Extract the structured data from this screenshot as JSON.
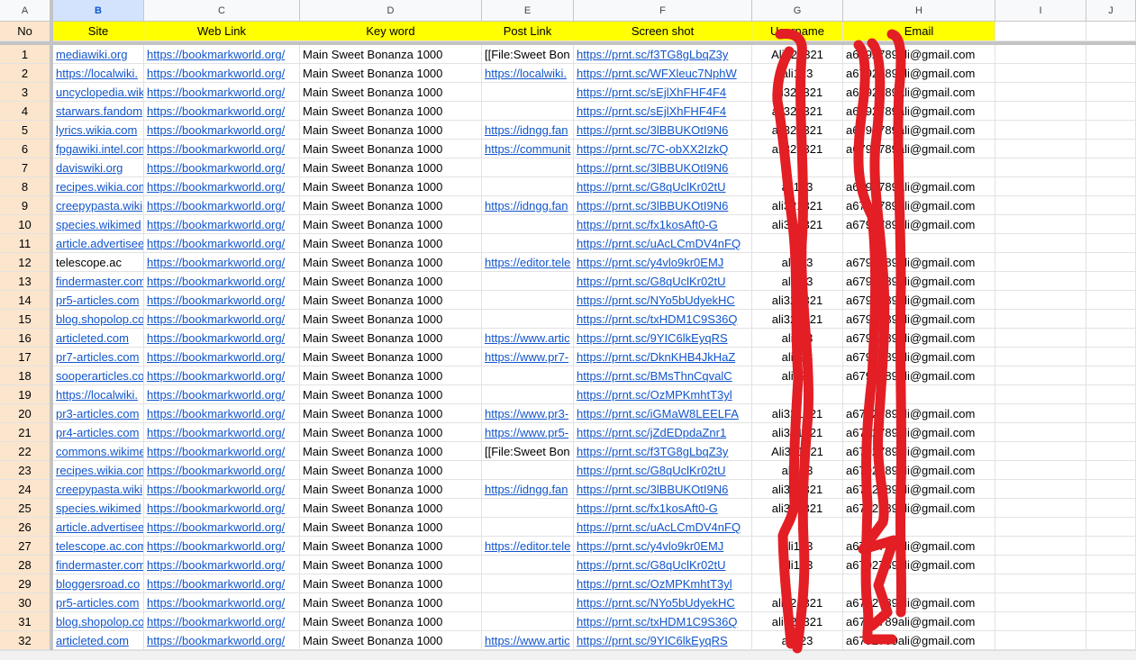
{
  "columns": [
    "A",
    "B",
    "C",
    "D",
    "E",
    "F",
    "G",
    "H",
    "I",
    "J"
  ],
  "selected_column": "B",
  "headers": [
    "No",
    "Site",
    "Web Link",
    "Key word",
    "Post  Link",
    "Screen shot",
    "Username",
    "Email",
    "",
    ""
  ],
  "colors": {
    "header_bg": "#ffff00",
    "no_bg": "#fce5cd",
    "link": "#1155cc",
    "scribble": "#e31e24"
  },
  "rows": [
    {
      "no": "1",
      "site": "mediawiki.org",
      "web": "https://bookmarkworld.org/",
      "kw": "Main Sweet Bonanza 1000",
      "post": "[[File:Sweet Bon",
      "post_link": false,
      "shot": "https://prnt.sc/f3TG8gLbqZ3y",
      "user": "Ali321321",
      "email": "a6792789ali@gmail.com"
    },
    {
      "no": "2",
      "site": "https://localwiki.",
      "web": "https://bookmarkworld.org/",
      "kw": "Main Sweet Bonanza 1000",
      "post": "https://localwiki.",
      "shot": "https://prnt.sc/WFXleuc7NphW",
      "user": "ali123",
      "email": "a6792789ali@gmail.com"
    },
    {
      "no": "3",
      "site": "uncyclopedia.wiki",
      "web": "https://bookmarkworld.org/",
      "kw": "Main Sweet Bonanza 1000",
      "post": "",
      "shot": "https://prnt.sc/sEjlXhFHF4F4",
      "user": "ali321321",
      "email": "a6792789ali@gmail.com"
    },
    {
      "no": "4",
      "site": "starwars.fandom",
      "web": "https://bookmarkworld.org/",
      "kw": "Main Sweet Bonanza 1000",
      "post": "",
      "shot": "https://prnt.sc/sEjlXhFHF4F4",
      "user": "ali321321",
      "email": "a6792789ali@gmail.com"
    },
    {
      "no": "5",
      "site": "lyrics.wikia.com",
      "web": "https://bookmarkworld.org/",
      "kw": "Main Sweet Bonanza 1000",
      "post": "https://idngg.fan",
      "shot": "https://prnt.sc/3lBBUKOtI9N6",
      "user": "ali321321",
      "email": "a6792789ali@gmail.com"
    },
    {
      "no": "6",
      "site": "fpgawiki.intel.com",
      "web": "https://bookmarkworld.org/",
      "kw": "Main Sweet Bonanza 1000",
      "post": "https://communit",
      "shot": "https://prnt.sc/7C-obXX2IzkQ",
      "user": "ali321321",
      "email": "a6792789ali@gmail.com"
    },
    {
      "no": "7",
      "site": "daviswiki.org",
      "web": "https://bookmarkworld.org/",
      "kw": "Main Sweet Bonanza 1000",
      "post": "",
      "shot": "https://prnt.sc/3lBBUKOtI9N6",
      "user": "",
      "email": ""
    },
    {
      "no": "8",
      "site": "recipes.wikia.com",
      "web": "https://bookmarkworld.org/",
      "kw": "Main Sweet Bonanza 1000",
      "post": "",
      "shot": "https://prnt.sc/G8qUclKr02tU",
      "user": "ali123",
      "email": "a6792789ali@gmail.com"
    },
    {
      "no": "9",
      "site": "creepypasta.wiki",
      "web": "https://bookmarkworld.org/",
      "kw": "Main Sweet Bonanza 1000",
      "post": "https://idngg.fan",
      "shot": "https://prnt.sc/3lBBUKOtI9N6",
      "user": "ali321321",
      "email": "a6792789ali@gmail.com"
    },
    {
      "no": "10",
      "site": "species.wikimed",
      "web": "https://bookmarkworld.org/",
      "kw": "Main Sweet Bonanza 1000",
      "post": "",
      "shot": "https://prnt.sc/fx1kosAft0-G",
      "user": "ali321321",
      "email": "a6792789ali@gmail.com"
    },
    {
      "no": "11",
      "site": "article.advertisee",
      "web": "https://bookmarkworld.org/",
      "kw": "Main Sweet Bonanza 1000",
      "post": "",
      "shot": "https://prnt.sc/uAcLCmDV4nFQ",
      "user": "",
      "email": ""
    },
    {
      "no": "12",
      "site": "telescope.ac",
      "site_plain": true,
      "web": "https://bookmarkworld.org/",
      "kw": "Main Sweet Bonanza 1000",
      "post": "https://editor.tele",
      "shot": "https://prnt.sc/y4vlo9kr0EMJ",
      "user": "ali123",
      "email": "a6792789ali@gmail.com"
    },
    {
      "no": "13",
      "site": "findermaster.com",
      "web": "https://bookmarkworld.org/",
      "kw": "Main Sweet Bonanza 1000",
      "post": "",
      "shot": "https://prnt.sc/G8qUclKr02tU",
      "user": "ali123",
      "email": "a6792789ali@gmail.com"
    },
    {
      "no": "14",
      "site": "pr5-articles.com",
      "web": "https://bookmarkworld.org/",
      "kw": "Main Sweet Bonanza 1000",
      "post": "",
      "shot": "https://prnt.sc/NYo5bUdyekHC",
      "user": "ali321321",
      "email": "a6792789ali@gmail.com"
    },
    {
      "no": "15",
      "site": "blog.shopolop.co",
      "web": "https://bookmarkworld.org/",
      "kw": "Main Sweet Bonanza 1000",
      "post": "",
      "shot": "https://prnt.sc/txHDM1C9S36Q",
      "user": "ali321321",
      "email": "a6792789ali@gmail.com"
    },
    {
      "no": "16",
      "site": "articleted.com",
      "web": "https://bookmarkworld.org/",
      "kw": "Main Sweet Bonanza 1000",
      "post": "https://www.artic",
      "shot": "https://prnt.sc/9YIC6lkEyqRS",
      "user": "ali123",
      "email": "a6792789ali@gmail.com"
    },
    {
      "no": "17",
      "site": "pr7-articles.com",
      "web": "https://bookmarkworld.org/",
      "kw": "Main Sweet Bonanza 1000",
      "post": "https://www.pr7-",
      "shot": "https://prnt.sc/DknKHB4JkHaZ",
      "user": "ali123",
      "email": "a6792789ali@gmail.com"
    },
    {
      "no": "18",
      "site": "sooperarticles.co",
      "web": "https://bookmarkworld.org/",
      "kw": "Main Sweet Bonanza 1000",
      "post": "",
      "shot": "https://prnt.sc/BMsThnCqvalC",
      "user": "ali123",
      "email": "a6792789ali@gmail.com"
    },
    {
      "no": "19",
      "site": "https://localwiki.",
      "web": "https://bookmarkworld.org/",
      "kw": "Main Sweet Bonanza 1000",
      "post": "",
      "shot": "https://prnt.sc/OzMPKmhtT3yl",
      "user": "",
      "email": ""
    },
    {
      "no": "20",
      "site": "pr3-articles.com",
      "web": "https://bookmarkworld.org/",
      "kw": "Main Sweet Bonanza 1000",
      "post": "https://www.pr3-",
      "shot": "https://prnt.sc/iGMaW8LEELFA",
      "user": "ali321321",
      "email": "a6792789ali@gmail.com"
    },
    {
      "no": "21",
      "site": "pr4-articles.com",
      "web": "https://bookmarkworld.org/",
      "kw": "Main Sweet Bonanza 1000",
      "post": "https://www.pr5-",
      "shot": "https://prnt.sc/jZdEDpdaZnr1",
      "user": "ali321321",
      "email": "a6792789ali@gmail.com"
    },
    {
      "no": "22",
      "site": "commons.wikime",
      "web": "https://bookmarkworld.org/",
      "kw": "Main Sweet Bonanza 1000",
      "post": "[[File:Sweet Bon",
      "post_link": false,
      "shot": "https://prnt.sc/f3TG8gLbqZ3y",
      "user": "Ali321321",
      "email": "a6792789ali@gmail.com"
    },
    {
      "no": "23",
      "site": "recipes.wikia.com",
      "web": "https://bookmarkworld.org/",
      "kw": "Main Sweet Bonanza 1000",
      "post": "",
      "shot": "https://prnt.sc/G8qUclKr02tU",
      "user": "ali123",
      "email": "a6792789ali@gmail.com"
    },
    {
      "no": "24",
      "site": "creepypasta.wiki",
      "web": "https://bookmarkworld.org/",
      "kw": "Main Sweet Bonanza 1000",
      "post": "https://idngg.fan",
      "shot": "https://prnt.sc/3lBBUKOtI9N6",
      "user": "ali321321",
      "email": "a6792789ali@gmail.com"
    },
    {
      "no": "25",
      "site": "species.wikimed",
      "web": "https://bookmarkworld.org/",
      "kw": "Main Sweet Bonanza 1000",
      "post": "",
      "shot": "https://prnt.sc/fx1kosAft0-G",
      "user": "ali321321",
      "email": "a6792789ali@gmail.com"
    },
    {
      "no": "26",
      "site": "article.advertisee",
      "web": "https://bookmarkworld.org/",
      "kw": "Main Sweet Bonanza 1000",
      "post": "",
      "shot": "https://prnt.sc/uAcLCmDV4nFQ",
      "user": "",
      "email": ""
    },
    {
      "no": "27",
      "site": "telescope.ac.com",
      "web": "https://bookmarkworld.org/",
      "kw": "Main Sweet Bonanza 1000",
      "post": "https://editor.tele",
      "shot": "https://prnt.sc/y4vlo9kr0EMJ",
      "user": "ali123",
      "email": "a6792789ali@gmail.com"
    },
    {
      "no": "28",
      "site": "findermaster.com",
      "web": "https://bookmarkworld.org/",
      "kw": "Main Sweet Bonanza 1000",
      "post": "",
      "shot": "https://prnt.sc/G8qUclKr02tU",
      "user": "ali123",
      "email": "a6792789ali@gmail.com"
    },
    {
      "no": "29",
      "site": "bloggersroad.co",
      "web": "https://bookmarkworld.org/",
      "kw": "Main Sweet Bonanza 1000",
      "post": "",
      "shot": "https://prnt.sc/OzMPKmhtT3yl",
      "user": "",
      "email": ""
    },
    {
      "no": "30",
      "site": "pr5-articles.com",
      "web": "https://bookmarkworld.org/",
      "kw": "Main Sweet Bonanza 1000",
      "post": "",
      "shot": "https://prnt.sc/NYo5bUdyekHC",
      "user": "ali321321",
      "email": "a6792789ali@gmail.com"
    },
    {
      "no": "31",
      "site": "blog.shopolop.co",
      "web": "https://bookmarkworld.org/",
      "kw": "Main Sweet Bonanza 1000",
      "post": "",
      "shot": "https://prnt.sc/txHDM1C9S36Q",
      "user": "ali321321",
      "email": "a6792789ali@gmail.com"
    },
    {
      "no": "32",
      "site": "articleted.com",
      "web": "https://bookmarkworld.org/",
      "kw": "Main Sweet Bonanza 1000",
      "post": "https://www.artic",
      "shot": "https://prnt.sc/9YIC6lkEyqRS",
      "user": "ali123",
      "email": "a6792789ali@gmail.com"
    }
  ]
}
